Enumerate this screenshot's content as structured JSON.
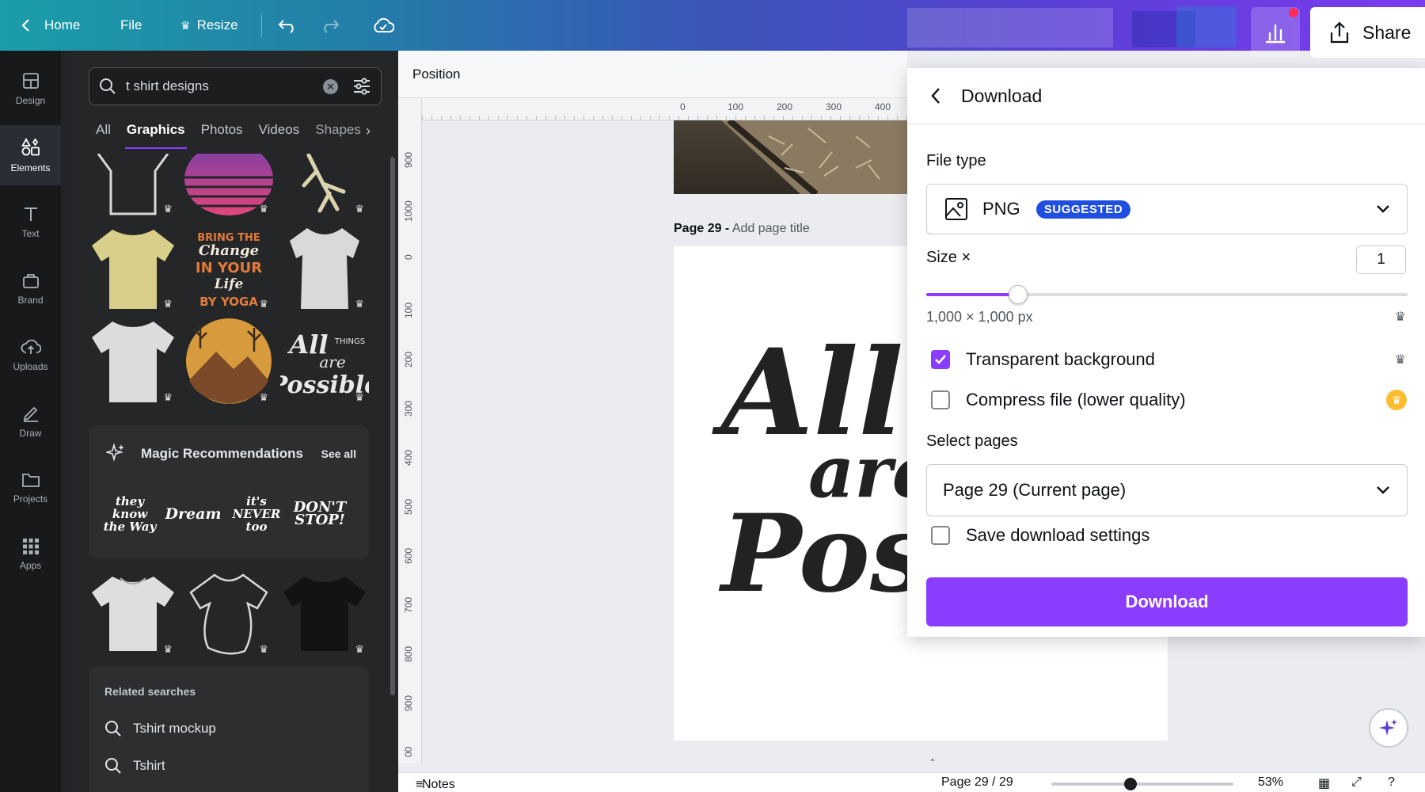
{
  "topbar": {
    "home": "Home",
    "file": "File",
    "resize": "Resize",
    "share": "Share"
  },
  "rail": [
    {
      "label": "Design",
      "icon": "design-icon"
    },
    {
      "label": "Elements",
      "icon": "elements-icon",
      "active": true
    },
    {
      "label": "Text",
      "icon": "text-icon"
    },
    {
      "label": "Brand",
      "icon": "brand-icon"
    },
    {
      "label": "Uploads",
      "icon": "uploads-icon"
    },
    {
      "label": "Draw",
      "icon": "draw-icon"
    },
    {
      "label": "Projects",
      "icon": "projects-icon"
    },
    {
      "label": "Apps",
      "icon": "apps-icon"
    }
  ],
  "panel": {
    "search_value": "t shirt designs",
    "tabs": [
      "All",
      "Graphics",
      "Photos",
      "Videos",
      "Shapes"
    ],
    "active_tab": "Graphics",
    "magic_title": "Magic Recommendations",
    "see_all": "See all",
    "related_header": "Related searches",
    "related": [
      "Tshirt mockup",
      "Tshirt"
    ]
  },
  "editor": {
    "toolbar_label": "Position",
    "ruler_top": [
      "0",
      "100",
      "200",
      "300",
      "400"
    ],
    "ruler_left": [
      "900",
      "1000",
      "0",
      "100",
      "200",
      "300",
      "400",
      "500",
      "600",
      "700",
      "800",
      "900",
      "00"
    ],
    "page_name": "Page 29 -",
    "page_title_placeholder": "Add page title",
    "page_art_lines": [
      "All",
      "are",
      "Poss"
    ]
  },
  "footer": {
    "notes": "Notes",
    "page_counter": "Page 29 / 29",
    "zoom": "53%"
  },
  "download": {
    "title": "Download",
    "file_type_label": "File type",
    "file_type_value": "PNG",
    "suggested_badge": "SUGGESTED",
    "size_label": "Size ×",
    "size_value": "1",
    "size_slider_fraction": 0.19,
    "dimensions": "1,000 × 1,000 px",
    "transparent_label": "Transparent background",
    "transparent_checked": true,
    "compress_label": "Compress file (lower quality)",
    "compress_checked": false,
    "select_pages_label": "Select pages",
    "select_pages_value": "Page 29 (Current page)",
    "save_settings_label": "Save download settings",
    "save_settings_checked": false,
    "download_button": "Download"
  },
  "colors": {
    "accent": "#8b3dff",
    "badge_blue": "#1f4fe0",
    "gold": "#fdbd2d"
  }
}
